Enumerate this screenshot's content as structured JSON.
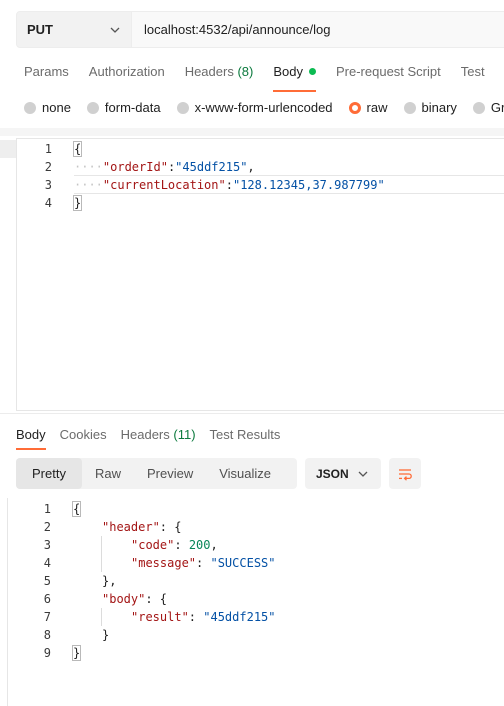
{
  "request": {
    "method": "PUT",
    "url": "localhost:4532/api/announce/log"
  },
  "request_tabs": [
    {
      "label": "Params"
    },
    {
      "label": "Authorization"
    },
    {
      "label": "Headers",
      "count": "(8)"
    },
    {
      "label": "Body",
      "active": true
    },
    {
      "label": "Pre-request Script"
    },
    {
      "label": "Test"
    }
  ],
  "body_types": [
    {
      "label": "none"
    },
    {
      "label": "form-data"
    },
    {
      "label": "x-www-form-urlencoded"
    },
    {
      "label": "raw",
      "selected": true
    },
    {
      "label": "binary"
    },
    {
      "label": "Gr"
    }
  ],
  "request_body": {
    "line_numbers": [
      "1",
      "2",
      "3",
      "4"
    ],
    "open_brace": "{",
    "close_brace": "}",
    "fields": [
      {
        "indent": "····",
        "key": "\"orderId\"",
        "sep": ":",
        "value": "\"45ddf215\"",
        "trail": ","
      },
      {
        "indent": "····",
        "key": "\"currentLocation\"",
        "sep": ":",
        "value": "\"128.12345,37.987799\"",
        "trail": ""
      }
    ]
  },
  "response_tabs": [
    {
      "label": "Body",
      "active": true
    },
    {
      "label": "Cookies"
    },
    {
      "label": "Headers",
      "count": "(11)"
    },
    {
      "label": "Test Results"
    }
  ],
  "response_views": [
    "Pretty",
    "Raw",
    "Preview",
    "Visualize"
  ],
  "response_format": "JSON",
  "response_body": {
    "line_numbers": [
      "1",
      "2",
      "3",
      "4",
      "5",
      "6",
      "7",
      "8",
      "9"
    ],
    "l1": "{",
    "header_key": "\"header\"",
    "header_open": ": {",
    "code_key": "\"code\"",
    "code_val": "200",
    "message_key": "\"message\"",
    "message_val": "\"SUCCESS\"",
    "header_close": "},",
    "body_key": "\"body\"",
    "body_open": ": {",
    "result_key": "\"result\"",
    "result_val": "\"45ddf215\"",
    "body_close": "}",
    "l9": "}"
  },
  "colors": {
    "accent": "#ff6c37",
    "status_dot": "#0cbb52",
    "count": "#0c7a3e",
    "json_key": "#a31515",
    "json_string": "#0451a5",
    "json_number": "#098658"
  },
  "icons": [
    "chevron-down-icon",
    "chevron-down-icon",
    "wrap-lines-icon"
  ]
}
